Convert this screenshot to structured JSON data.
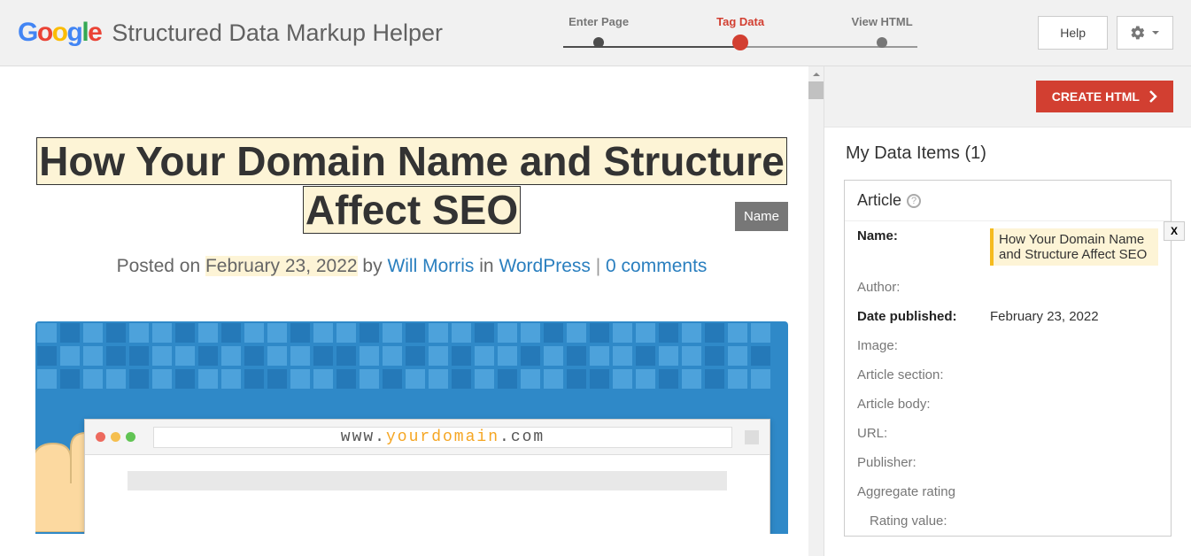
{
  "header": {
    "app_title": "Structured Data Markup Helper",
    "steps": [
      "Enter Page",
      "Tag Data",
      "View HTML"
    ],
    "active_step_index": 1,
    "help_label": "Help"
  },
  "tooltip": {
    "name_label": "Name"
  },
  "article": {
    "title_line1": "How Your Domain Name and Structure",
    "title_line2": "Affect SEO",
    "posted_on_prefix": "Posted on ",
    "date": "February 23, 2022",
    "by_text": " by ",
    "author": "Will Morris",
    "in_text": " in ",
    "category": "WordPress",
    "separator": " | ",
    "comments": "0 comments",
    "mock_url_prefix": "www.",
    "mock_url_domain": "yourdomain",
    "mock_url_suffix": ".com"
  },
  "side": {
    "create_label": "CREATE HTML",
    "my_items_label": "My Data Items (1)",
    "card_title": "Article",
    "fields": {
      "name_label": "Name:",
      "name_value": "How Your Domain Name and Structure Affect SEO",
      "author_label": "Author:",
      "date_published_label": "Date published:",
      "date_published_value": "February 23, 2022",
      "image_label": "Image:",
      "section_label": "Article section:",
      "body_label": "Article body:",
      "url_label": "URL:",
      "publisher_label": "Publisher:",
      "agg_label": "Aggregate rating",
      "rating_value_label": "Rating value:"
    },
    "x_label": "X"
  }
}
